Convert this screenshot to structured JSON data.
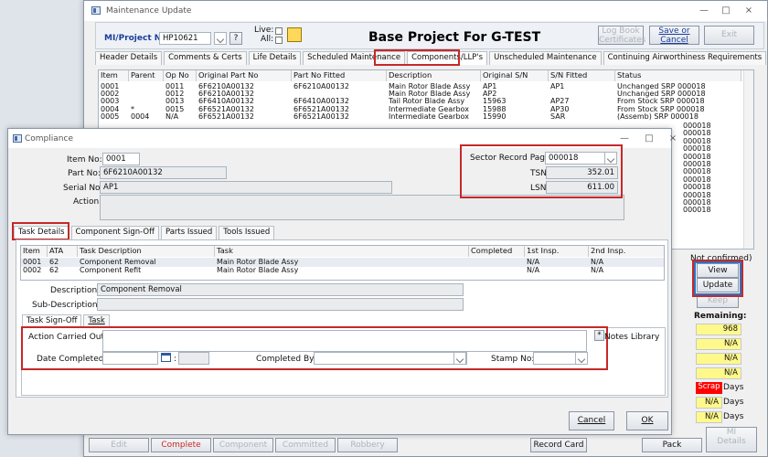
{
  "background_window": {
    "title": "Maintenance Update",
    "project_label": "MI/Project No:",
    "project_value": "HP10621",
    "live_label": "Live:",
    "all_label": "All:",
    "project_title": "Base Project For G-TEST",
    "logbook_button": "Log Book\nCertificates",
    "save_button": "Save or\nCancel",
    "exit_button": "Exit",
    "tabs": [
      "Header Details",
      "Comments & Certs",
      "Life Details",
      "Scheduled Maintenance",
      "Components/LLP's",
      "Unscheduled Maintenance",
      "Continuing Airworthiness Requirements"
    ],
    "table_headers": [
      "Item",
      "Parent",
      "Op No",
      "Original Part No",
      "Part No Fitted",
      "Description",
      "Original S/N",
      "S/N Fitted",
      "Status"
    ],
    "rows": [
      [
        "0001",
        "",
        "0011",
        "6F6210A00132",
        "6F6210A00132",
        "Main Rotor Blade Assy",
        "AP1",
        "AP1",
        "Unchanged SRP 000018"
      ],
      [
        "0002",
        "",
        "0012",
        "6F6210A00132",
        "",
        "Main Rotor Blade Assy",
        "AP2",
        "",
        "Unchanged SRP 000018"
      ],
      [
        "0003",
        "",
        "0013",
        "6F6410A00132",
        "6F6410A00132",
        "Tail Rotor Blade Assy",
        "15963",
        "AP27",
        "From Stock SRP 000018"
      ],
      [
        "0004",
        "*",
        "0015",
        "6F6521A00132",
        "6F6521A00132",
        "Intermediate Gearbox",
        "15988",
        "AP30",
        "From Stock SRP 000018"
      ],
      [
        "0005",
        "0004",
        "N/A",
        "6F6521A00132",
        "6F6521A00132",
        "Intermediate Gearbox",
        "15990",
        "SAR",
        "(Assemb) SRP 000018"
      ]
    ],
    "status_tail": [
      "000018",
      "000018",
      "000018",
      "000018",
      "000018",
      "000018",
      "000018",
      "000018",
      "000018",
      "000018",
      "000018",
      "000018"
    ],
    "not_confirmed": "Not confirmed)",
    "view_button": "View",
    "update_button": "Update",
    "keep_button": "Keep",
    "remaining_label": "Remaining:",
    "remaining_values": [
      "968",
      "N/A",
      "N/A",
      "N/A"
    ],
    "scrap_label": "Scrap",
    "days_label": "Days",
    "days_values": [
      "N/A",
      "N/A"
    ],
    "bottom_buttons": [
      "Edit",
      "Complete",
      "Component",
      "Committed",
      "Robbery",
      "Record Card",
      "Pack",
      "MI\nDetails"
    ]
  },
  "compliance": {
    "title": "Compliance",
    "item_label": "Item No:",
    "item_value": "0001",
    "part_label": "Part No:",
    "part_value": "6F6210A00132",
    "serial_label": "Serial No:",
    "serial_value": "AP1",
    "action_label": "Action:",
    "sector_label": "Sector Record Page:",
    "sector_value": "000018",
    "tsn_label": "TSN:",
    "tsn_value": "352.01",
    "lsn_label": "LSN:",
    "lsn_value": "611.00",
    "tabs": [
      "Task Details",
      "Component Sign-Off",
      "Parts Issued",
      "Tools Issued"
    ],
    "task_headers": [
      "Item",
      "ATA",
      "Task Description",
      "Task",
      "Completed",
      "1st Insp.",
      "2nd Insp."
    ],
    "task_rows": [
      [
        "0001",
        "62",
        "Component Removal",
        "Main Rotor Blade Assy",
        "",
        "N/A",
        "N/A"
      ],
      [
        "0002",
        "62",
        "Component Refit",
        "Main Rotor Blade Assy",
        "",
        "N/A",
        "N/A"
      ]
    ],
    "description_label": "Description:",
    "description_value": "Component Removal",
    "subdescription_label": "Sub-Description:",
    "subtabs": [
      "Task Sign-Off",
      "Task"
    ],
    "action_carried_label": "Action Carried Out:",
    "notes_library": "Notes Library",
    "date_label": "Date Completed:",
    "completed_by_label": "Completed By:",
    "stamp_label": "Stamp No:",
    "cancel_button": "Cancel",
    "ok_button": "OK",
    "accent_red": "#c62828",
    "accent_blue": "#2b72c5"
  }
}
